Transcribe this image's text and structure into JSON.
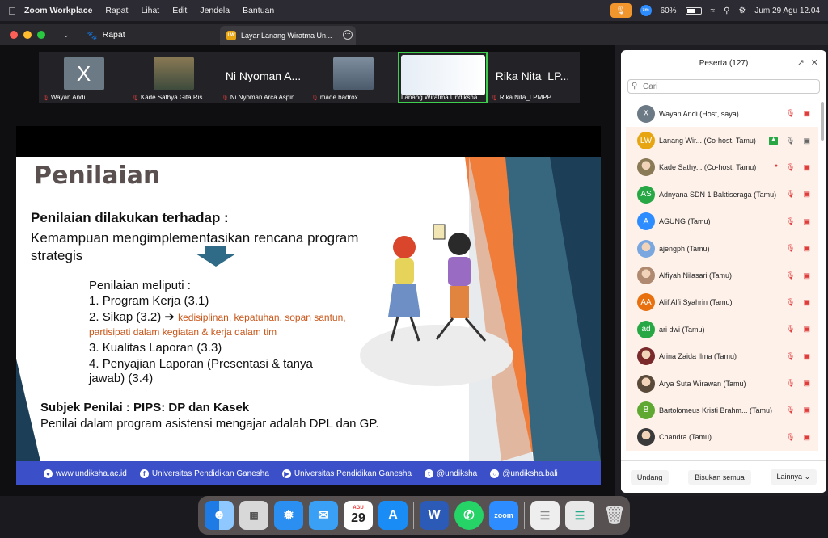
{
  "menubar": {
    "items": [
      "Zoom Workplace",
      "Rapat",
      "Lihat",
      "Edit",
      "Jendela",
      "Bantuan"
    ],
    "battery": "60%",
    "zoom_badge": "zm",
    "datetime": "Jum 29 Agu  12.04"
  },
  "window": {
    "tab_rapat": "Rapat",
    "tab_share": "Layar Lanang Wiratma Un...",
    "tab_share_badge": "LW"
  },
  "participants_strip": [
    {
      "avatar": "X",
      "label": "Wayan Andi",
      "color": "#6c7a86"
    },
    {
      "avatar": "",
      "label": "Kade Sathya Gita Ris...",
      "color": "#8a7a55"
    },
    {
      "avatar": "",
      "big": "Ni Nyoman A...",
      "label": "Ni Nyoman Arca Aspin...",
      "color": ""
    },
    {
      "avatar": "",
      "label": "made badrox",
      "color": "#4a5a6a"
    },
    {
      "avatar": "",
      "label": "Lanang Wiratma Undiksha",
      "color": "#cfd8e6"
    },
    {
      "avatar": "",
      "big": "Rika Nita_LP...",
      "label": "Rika Nita_LPMPP",
      "color": ""
    }
  ],
  "slide": {
    "title": "Penilaian",
    "line1": "Penilaian  dilakukan terhadap :",
    "line2": "Kemampuan mengimplementasikan rencana program strategis",
    "sub": "Penilaian meliputi :",
    "items": [
      {
        "num": "1.",
        "text": "Program Kerja (3.1)",
        "extra": ""
      },
      {
        "num": "2.",
        "text": "Sikap (3.2) ➔ ",
        "extra": "kedisiplinan, kepatuhan, sopan santun, partisipati dalam kegiatan & kerja dalam tim"
      },
      {
        "num": "3.",
        "text": "Kualitas Laporan (3.3)",
        "extra": ""
      },
      {
        "num": "4.",
        "text": "Penyajian Laporan (Presentasi & tanya jawab) (3.4)",
        "extra": ""
      }
    ],
    "subjek": "Subjek Penilai : PIPS: DP dan Kasek",
    "penilai": "Penilai dalam program asistensi mengajar adalah DPL dan GP.",
    "footer": {
      "web": "www.undiksha.ac.id",
      "fb": "Universitas Pendidikan Ganesha",
      "yt": "Universitas Pendidikan Ganesha",
      "tw": "@undiksha",
      "ig": "@undiksha.bali"
    }
  },
  "panel": {
    "title": "Peserta (127)",
    "search_placeholder": "Cari",
    "participants": [
      {
        "init": "X",
        "name": "Wayan Andi (Host, saya)",
        "color": "#6c7a86",
        "photo": false
      },
      {
        "init": "LW",
        "name": "Lanang Wir...   (Co-host, Tamu)",
        "color": "#e8a512",
        "photo": false
      },
      {
        "init": "",
        "name": "Kade Sathy...   (Co-host, Tamu)",
        "color": "#8a7a55",
        "photo": true
      },
      {
        "init": "AS",
        "name": "Adnyana SDN 1 Baktiseraga  (Tamu)",
        "color": "#27a844",
        "photo": false
      },
      {
        "init": "A",
        "name": "AGUNG (Tamu)",
        "color": "#2d8cff",
        "photo": false
      },
      {
        "init": "",
        "name": "ajengph (Tamu)",
        "color": "#7aa7e0",
        "photo": true
      },
      {
        "init": "",
        "name": "Alfiyah Nilasari (Tamu)",
        "color": "#b08a70",
        "photo": true
      },
      {
        "init": "AA",
        "name": "Alif Alfi Syahrin (Tamu)",
        "color": "#e8700f",
        "photo": false
      },
      {
        "init": "ad",
        "name": "ari dwi (Tamu)",
        "color": "#27a844",
        "photo": false
      },
      {
        "init": "",
        "name": "Arina Zaida Ilma (Tamu)",
        "color": "#7a2a2a",
        "photo": true
      },
      {
        "init": "",
        "name": "Arya Suta Wirawan (Tamu)",
        "color": "#5a4a3a",
        "photo": true
      },
      {
        "init": "B",
        "name": "Bartolomeus Kristi Brahm...  (Tamu)",
        "color": "#5fa832",
        "photo": false
      },
      {
        "init": "",
        "name": "Chandra (Tamu)",
        "color": "#3a3a3a",
        "photo": true
      }
    ],
    "buttons": {
      "invite": "Undang",
      "mute_all": "Bisukan semua",
      "more": "Lainnya"
    }
  },
  "dock": {
    "calendar_month": "AGU",
    "calendar_day": "29",
    "zoom_label": "zoom"
  }
}
